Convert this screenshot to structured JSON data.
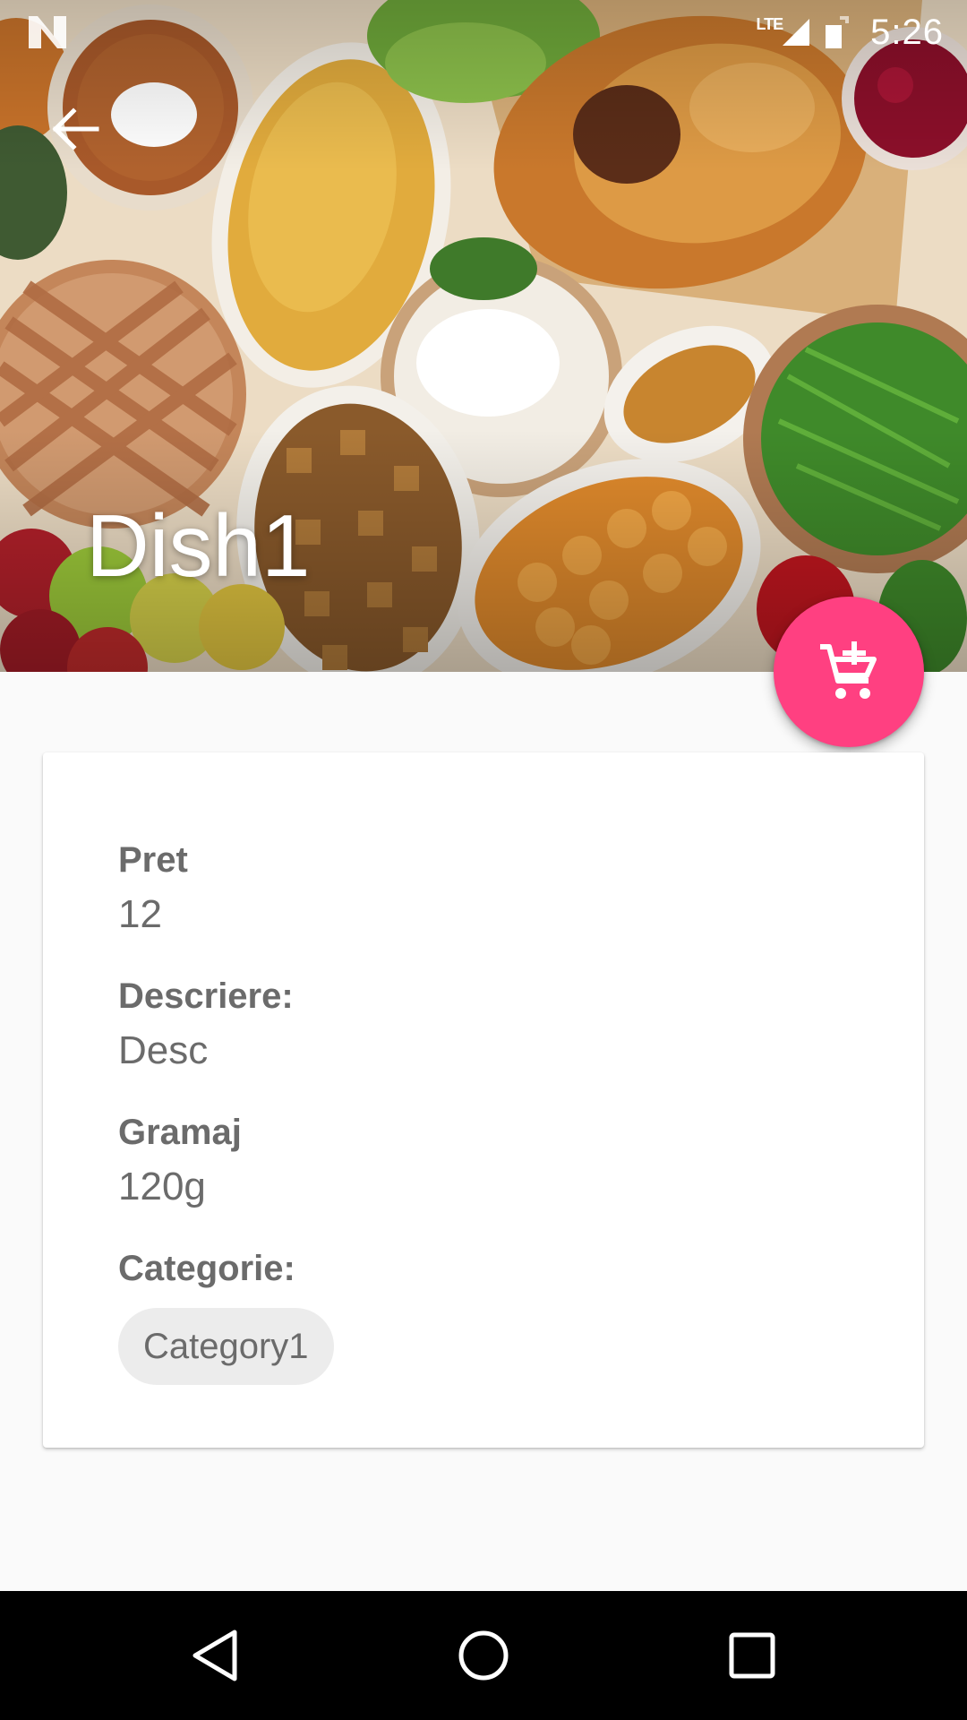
{
  "status_bar": {
    "network_label": "LTE",
    "time": "5:26"
  },
  "toolbar": {
    "title": "Dish1",
    "back_icon": "arrow-back-icon"
  },
  "fab": {
    "icon": "add-shopping-cart-icon",
    "color": "#ff4081"
  },
  "details": {
    "price_label": "Pret",
    "price_value": "12",
    "description_label": "Descriere:",
    "description_value": "Desc",
    "weight_label": "Gramaj",
    "weight_value": "120g",
    "category_label": "Categorie:",
    "categories": [
      "Category1"
    ]
  },
  "nav_bar": {
    "back_icon": "nav-back-icon",
    "home_icon": "nav-home-icon",
    "recents_icon": "nav-recents-icon"
  }
}
